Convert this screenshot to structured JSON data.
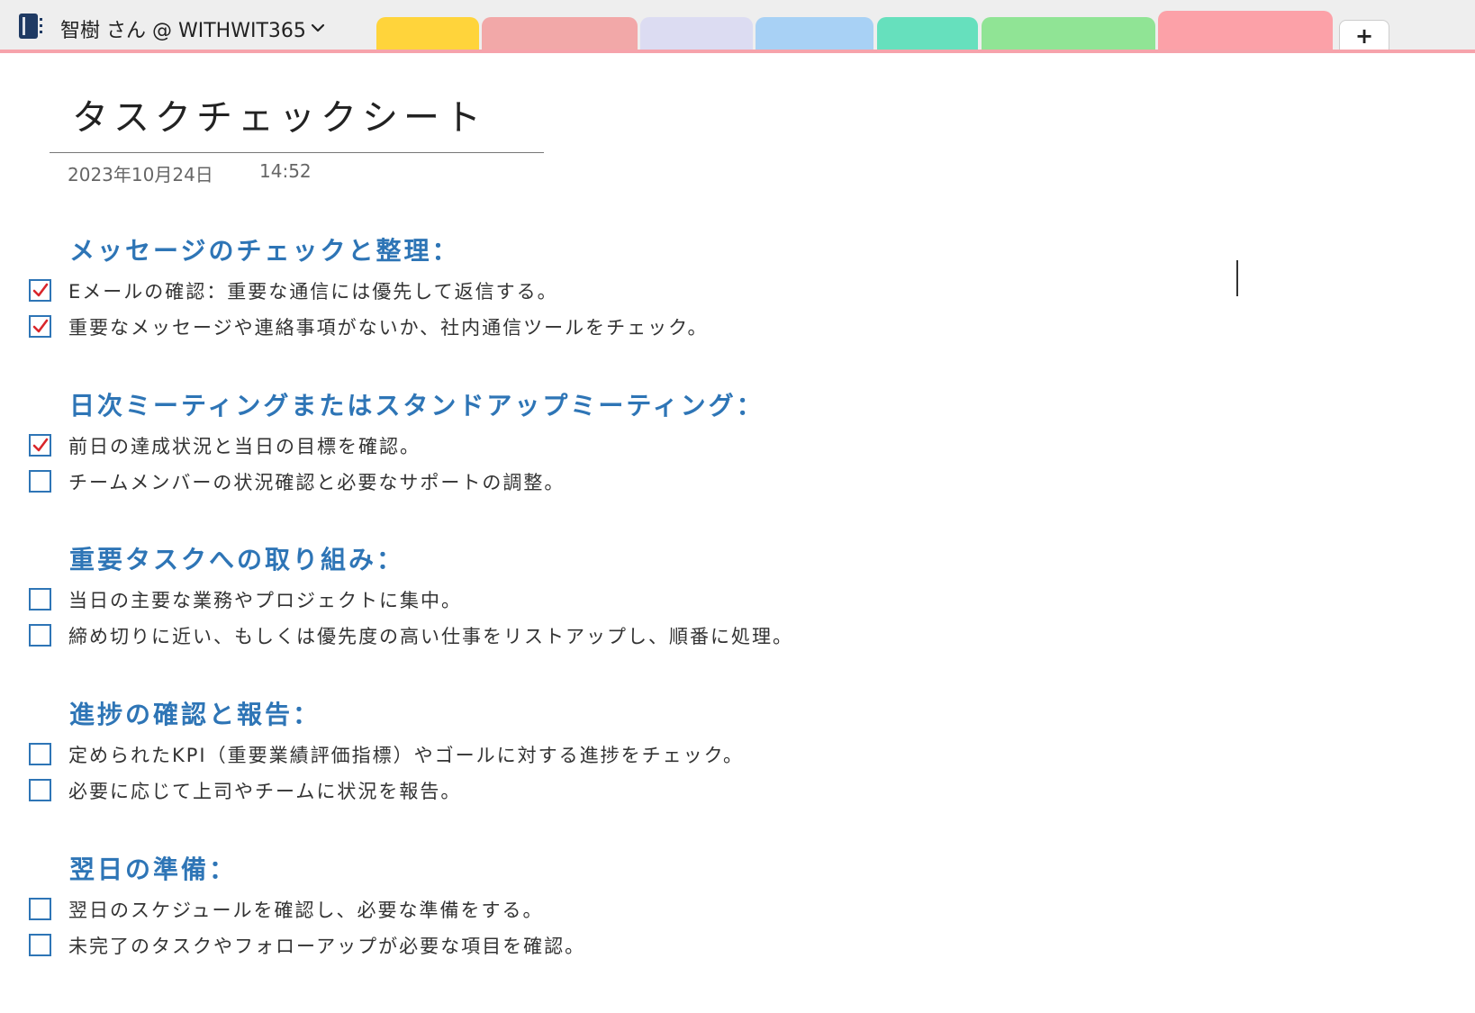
{
  "header": {
    "notebook_name": "智樹 さん @ WITHWIT365",
    "tabs": [
      {
        "color": "#ffd43b"
      },
      {
        "color": "#f2a8a8"
      },
      {
        "color": "#dcdcf2"
      },
      {
        "color": "#a8d1f5"
      },
      {
        "color": "#66e0bd"
      },
      {
        "color": "#90e495"
      },
      {
        "color": "#fca1a8",
        "active": true
      }
    ],
    "add_tab_label": "+",
    "accent_color": "#f6a3ab"
  },
  "page": {
    "title": "タスクチェックシート",
    "date": "2023年10月24日",
    "time": "14:52"
  },
  "sections": [
    {
      "heading": "メッセージのチェックと整理：",
      "items": [
        {
          "text": "Eメールの確認：重要な通信には優先して返信する。",
          "checked": true
        },
        {
          "text": "重要なメッセージや連絡事項がないか、社内通信ツールをチェック。",
          "checked": true
        }
      ]
    },
    {
      "heading": "日次ミーティングまたはスタンドアップミーティング：",
      "items": [
        {
          "text": "前日の達成状況と当日の目標を確認。",
          "checked": true
        },
        {
          "text": "チームメンバーの状況確認と必要なサポートの調整。",
          "checked": false
        }
      ]
    },
    {
      "heading": "重要タスクへの取り組み：",
      "items": [
        {
          "text": "当日の主要な業務やプロジェクトに集中。",
          "checked": false
        },
        {
          "text": "締め切りに近い、もしくは優先度の高い仕事をリストアップし、順番に処理。",
          "checked": false
        }
      ]
    },
    {
      "heading": "進捗の確認と報告：",
      "items": [
        {
          "text": "定められたKPI（重要業績評価指標）やゴールに対する進捗をチェック。",
          "checked": false
        },
        {
          "text": "必要に応じて上司やチームに状況を報告。",
          "checked": false
        }
      ]
    },
    {
      "heading": "翌日の準備：",
      "items": [
        {
          "text": "翌日のスケジュールを確認し、必要な準備をする。",
          "checked": false
        },
        {
          "text": "未完了のタスクやフォローアップが必要な項目を確認。",
          "checked": false
        }
      ]
    }
  ],
  "colors": {
    "heading": "#2e75b6",
    "checkbox_border": "#2e75b6",
    "checkmark": "#d9262b"
  }
}
